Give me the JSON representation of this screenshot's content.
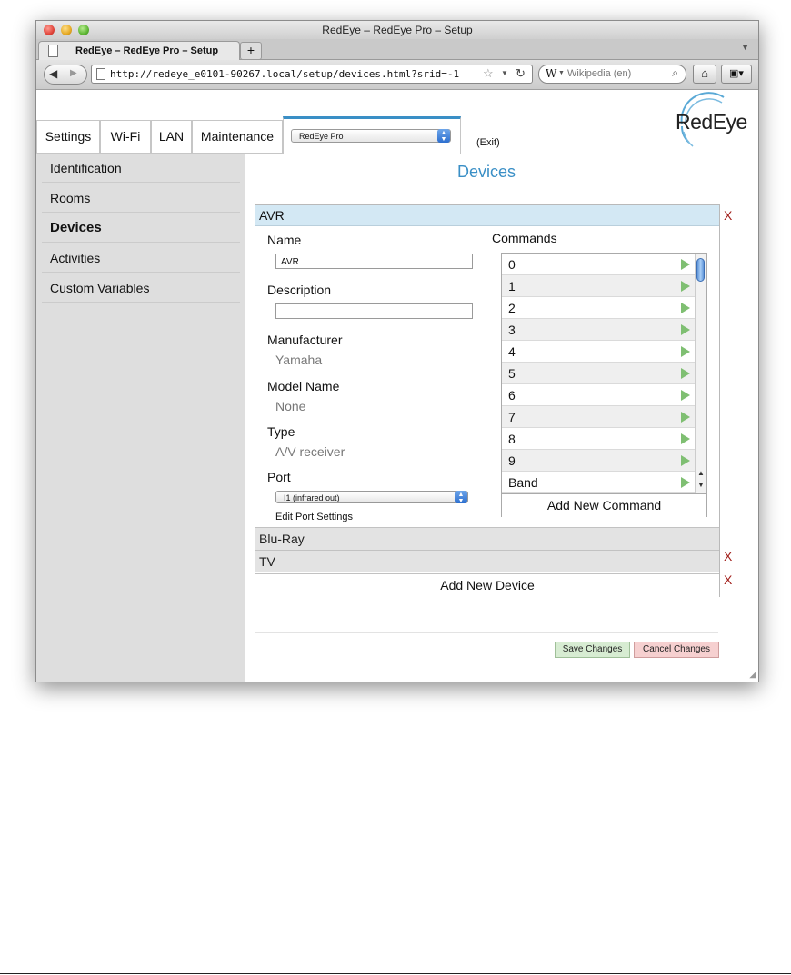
{
  "window": {
    "title": "RedEye – RedEye Pro – Setup"
  },
  "browser": {
    "tab_title": "RedEye – RedEye Pro – Setup",
    "new_tab_label": "+",
    "url": "http://redeye_e0101-90267.local/setup/devices.html?srid=-1",
    "search_engine_glyph": "W",
    "search_placeholder": "Wikipedia (en)"
  },
  "app": {
    "tabs": [
      {
        "label": "Settings"
      },
      {
        "label": "Wi-Fi"
      },
      {
        "label": "LAN"
      },
      {
        "label": "Maintenance"
      }
    ],
    "device_selector_value": "RedEye Pro",
    "exit_label": "(Exit)",
    "logo_text": "RedEye",
    "accent_color": "#3a8fc6"
  },
  "sidebar": {
    "items": [
      {
        "label": "Identification"
      },
      {
        "label": "Rooms"
      },
      {
        "label": "Devices",
        "active": true
      },
      {
        "label": "Activities"
      },
      {
        "label": "Custom Variables"
      }
    ]
  },
  "main": {
    "title": "Devices",
    "devices": [
      {
        "name": "AVR",
        "expanded": true
      },
      {
        "name": "Blu-Ray"
      },
      {
        "name": "TV"
      }
    ],
    "remove_label": "X",
    "form": {
      "name_label": "Name",
      "name_value": "AVR",
      "description_label": "Description",
      "description_value": "",
      "manufacturer_label": "Manufacturer",
      "manufacturer_value": "Yamaha",
      "model_label": "Model Name",
      "model_value": "None",
      "type_label": "Type",
      "type_value": "A/V receiver",
      "port_label": "Port",
      "port_value": "I1 (infrared out)",
      "edit_port_label": "Edit Port Settings"
    },
    "commands_label": "Commands",
    "commands": [
      "0",
      "1",
      "2",
      "3",
      "4",
      "5",
      "6",
      "7",
      "8",
      "9",
      "Band"
    ],
    "add_command_label": "Add New Command",
    "add_device_label": "Add New Device",
    "save_label": "Save Changes",
    "cancel_label": "Cancel Changes"
  }
}
